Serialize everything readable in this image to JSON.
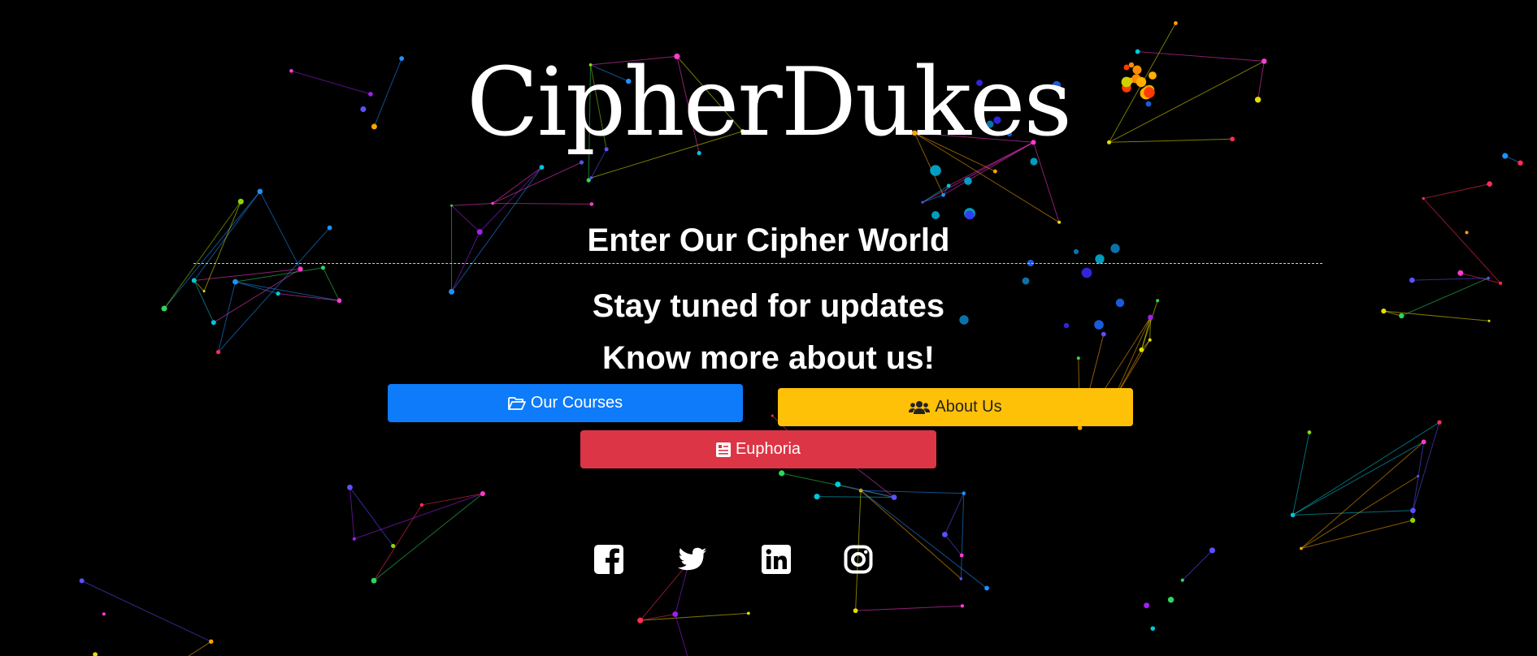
{
  "brand": {
    "title": "CipherDukes"
  },
  "hero": {
    "subtitle": "Enter Our Cipher World",
    "tagline_1": "Stay tuned for updates",
    "tagline_2": "Know more about us!"
  },
  "buttons": {
    "courses": {
      "label": "Our Courses",
      "icon": "folder-open-icon",
      "color": "#0d7bfa"
    },
    "about": {
      "label": "About Us",
      "icon": "users-icon",
      "color": "#ffc107"
    },
    "euphoria": {
      "label": "Euphoria",
      "icon": "newspaper-icon",
      "color": "#dc3545"
    }
  },
  "social": [
    "facebook-icon",
    "twitter-icon",
    "linkedin-icon",
    "instagram-icon"
  ],
  "colors": {
    "background": "#000000",
    "text": "#ffffff"
  }
}
